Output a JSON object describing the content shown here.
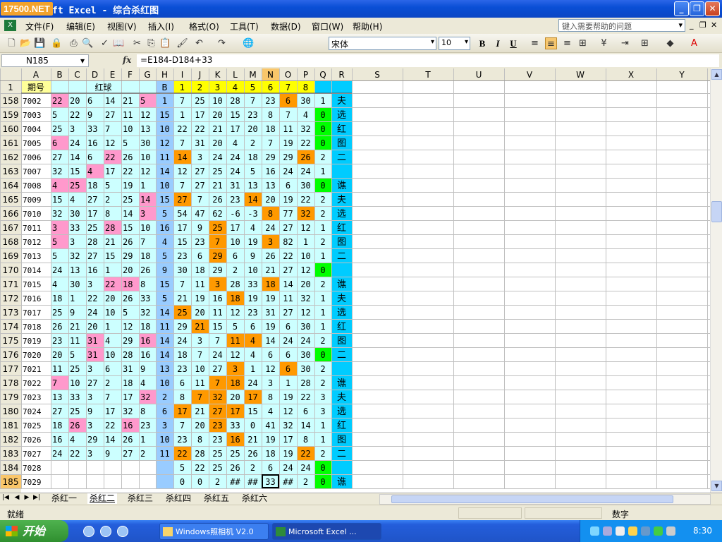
{
  "window": {
    "watermark": "17500.NET",
    "title": "ft Excel - 综合杀红图"
  },
  "menu": {
    "items": [
      "文件(F)",
      "编辑(E)",
      "视图(V)",
      "插入(I)",
      "格式(O)",
      "工具(T)",
      "数据(D)",
      "窗口(W)",
      "帮助(H)"
    ],
    "help_placeholder": "键入需要帮助的问题"
  },
  "toolbar": {
    "font": "宋体",
    "size": "10",
    "bold": "B",
    "italic": "I",
    "underline": "U"
  },
  "formula_bar": {
    "name_box": "N185",
    "fx": "fx",
    "formula": "=E184-D184+33"
  },
  "grid": {
    "columns": [
      "A",
      "B",
      "C",
      "D",
      "E",
      "F",
      "G",
      "H",
      "I",
      "J",
      "K",
      "L",
      "M",
      "N",
      "O",
      "P",
      "Q",
      "R",
      "S",
      "T",
      "U",
      "V",
      "W",
      "X",
      "Y"
    ],
    "header_row": {
      "row": "1",
      "a": "期号",
      "red": "红球",
      "h": "B",
      "nums": [
        "1",
        "2",
        "3",
        "4",
        "5",
        "6",
        "7",
        "8"
      ]
    },
    "rows": [
      [
        "158",
        "7002",
        "22",
        "20",
        "6",
        "14",
        "21",
        "5",
        "1",
        "7",
        "25",
        "10",
        "28",
        "7",
        "23",
        "6",
        "30",
        "1",
        "夫"
      ],
      [
        "159",
        "7003",
        "5",
        "22",
        "9",
        "27",
        "11",
        "12",
        "15",
        "1",
        "17",
        "20",
        "15",
        "23",
        "8",
        "7",
        "4",
        "0",
        "选"
      ],
      [
        "160",
        "7004",
        "25",
        "3",
        "33",
        "7",
        "10",
        "13",
        "10",
        "22",
        "22",
        "21",
        "17",
        "20",
        "18",
        "11",
        "32",
        "0",
        "红"
      ],
      [
        "161",
        "7005",
        "6",
        "24",
        "16",
        "12",
        "5",
        "30",
        "12",
        "7",
        "31",
        "20",
        "4",
        "2",
        "7",
        "19",
        "22",
        "0",
        "图"
      ],
      [
        "162",
        "7006",
        "27",
        "14",
        "6",
        "22",
        "26",
        "10",
        "11",
        "14",
        "3",
        "24",
        "24",
        "18",
        "29",
        "29",
        "26",
        "2",
        "二"
      ],
      [
        "163",
        "7007",
        "32",
        "15",
        "4",
        "17",
        "22",
        "12",
        "14",
        "12",
        "27",
        "25",
        "24",
        "5",
        "16",
        "24",
        "24",
        "1",
        ""
      ],
      [
        "164",
        "7008",
        "4",
        "25",
        "18",
        "5",
        "19",
        "1",
        "10",
        "7",
        "27",
        "21",
        "31",
        "13",
        "13",
        "6",
        "30",
        "0",
        "谯"
      ],
      [
        "165",
        "7009",
        "15",
        "4",
        "27",
        "2",
        "25",
        "14",
        "15",
        "27",
        "7",
        "26",
        "23",
        "14",
        "20",
        "19",
        "22",
        "2",
        "夫"
      ],
      [
        "166",
        "7010",
        "32",
        "30",
        "17",
        "8",
        "14",
        "3",
        "5",
        "54",
        "47",
        "62",
        "-6",
        "-3",
        "8",
        "77",
        "32",
        "2",
        "选"
      ],
      [
        "167",
        "7011",
        "3",
        "33",
        "25",
        "28",
        "15",
        "10",
        "16",
        "17",
        "9",
        "25",
        "17",
        "4",
        "24",
        "27",
        "12",
        "1",
        "红"
      ],
      [
        "168",
        "7012",
        "5",
        "3",
        "28",
        "21",
        "26",
        "7",
        "4",
        "15",
        "23",
        "7",
        "10",
        "19",
        "3",
        "82",
        "1",
        "2",
        "图"
      ],
      [
        "169",
        "7013",
        "5",
        "32",
        "27",
        "15",
        "29",
        "18",
        "5",
        "23",
        "6",
        "29",
        "6",
        "9",
        "26",
        "22",
        "10",
        "1",
        "二"
      ],
      [
        "170",
        "7014",
        "24",
        "13",
        "16",
        "1",
        "20",
        "26",
        "9",
        "30",
        "18",
        "29",
        "2",
        "10",
        "21",
        "27",
        "12",
        "0",
        ""
      ],
      [
        "171",
        "7015",
        "4",
        "30",
        "3",
        "22",
        "18",
        "8",
        "15",
        "7",
        "11",
        "3",
        "28",
        "33",
        "18",
        "14",
        "20",
        "2",
        "谯"
      ],
      [
        "172",
        "7016",
        "18",
        "1",
        "22",
        "20",
        "26",
        "33",
        "5",
        "21",
        "19",
        "16",
        "18",
        "19",
        "19",
        "11",
        "32",
        "1",
        "夫"
      ],
      [
        "173",
        "7017",
        "25",
        "9",
        "24",
        "10",
        "5",
        "32",
        "14",
        "25",
        "20",
        "11",
        "12",
        "23",
        "31",
        "27",
        "12",
        "1",
        "选"
      ],
      [
        "174",
        "7018",
        "26",
        "21",
        "20",
        "1",
        "12",
        "18",
        "11",
        "29",
        "21",
        "15",
        "5",
        "6",
        "19",
        "6",
        "30",
        "1",
        "红"
      ],
      [
        "175",
        "7019",
        "23",
        "11",
        "31",
        "4",
        "29",
        "16",
        "14",
        "24",
        "3",
        "7",
        "11",
        "4",
        "14",
        "24",
        "24",
        "2",
        "图"
      ],
      [
        "176",
        "7020",
        "20",
        "5",
        "31",
        "10",
        "28",
        "16",
        "14",
        "18",
        "7",
        "24",
        "12",
        "4",
        "6",
        "6",
        "30",
        "0",
        "二"
      ],
      [
        "177",
        "7021",
        "11",
        "25",
        "3",
        "6",
        "31",
        "9",
        "13",
        "23",
        "10",
        "27",
        "3",
        "1",
        "12",
        "6",
        "30",
        "2",
        ""
      ],
      [
        "178",
        "7022",
        "7",
        "10",
        "27",
        "2",
        "18",
        "4",
        "10",
        "6",
        "11",
        "7",
        "18",
        "24",
        "3",
        "1",
        "28",
        "2",
        "谯"
      ],
      [
        "179",
        "7023",
        "13",
        "33",
        "3",
        "7",
        "17",
        "32",
        "2",
        "8",
        "7",
        "32",
        "20",
        "17",
        "8",
        "19",
        "22",
        "3",
        "夫"
      ],
      [
        "180",
        "7024",
        "27",
        "25",
        "9",
        "17",
        "32",
        "8",
        "6",
        "17",
        "21",
        "27",
        "17",
        "15",
        "4",
        "12",
        "6",
        "3",
        "选"
      ],
      [
        "181",
        "7025",
        "18",
        "26",
        "3",
        "22",
        "16",
        "23",
        "3",
        "7",
        "20",
        "23",
        "33",
        "0",
        "41",
        "32",
        "14",
        "1",
        "红"
      ],
      [
        "182",
        "7026",
        "16",
        "4",
        "29",
        "14",
        "26",
        "1",
        "10",
        "23",
        "8",
        "23",
        "16",
        "21",
        "19",
        "17",
        "8",
        "1",
        "图"
      ],
      [
        "183",
        "7027",
        "24",
        "22",
        "3",
        "9",
        "27",
        "2",
        "11",
        "22",
        "28",
        "25",
        "25",
        "26",
        "18",
        "19",
        "22",
        "2",
        "二"
      ],
      [
        "184",
        "7028",
        "",
        "",
        "",
        "",
        "",
        "",
        "",
        "5",
        "22",
        "25",
        "26",
        "2",
        "6",
        "24",
        "24",
        "0",
        ""
      ],
      [
        "185",
        "7029",
        "",
        "",
        "",
        "",
        "",
        "",
        "",
        "0",
        "0",
        "2",
        "##",
        "##",
        "33",
        "##",
        "2",
        "0",
        "谯"
      ]
    ],
    "pink": [
      [
        158,
        "B"
      ],
      [
        158,
        "G"
      ],
      [
        161,
        "B"
      ],
      [
        162,
        "E"
      ],
      [
        163,
        "D"
      ],
      [
        164,
        "B"
      ],
      [
        164,
        "C"
      ],
      [
        165,
        "G"
      ],
      [
        166,
        "G"
      ],
      [
        167,
        "B"
      ],
      [
        167,
        "E"
      ],
      [
        168,
        "B"
      ],
      [
        171,
        "E"
      ],
      [
        171,
        "F"
      ],
      [
        175,
        "D"
      ],
      [
        175,
        "G"
      ],
      [
        176,
        "D"
      ],
      [
        178,
        "B"
      ],
      [
        179,
        "G"
      ],
      [
        181,
        "C"
      ],
      [
        181,
        "F"
      ]
    ],
    "orange": [
      [
        158,
        "O"
      ],
      [
        162,
        "I"
      ],
      [
        162,
        "P"
      ],
      [
        165,
        "I"
      ],
      [
        165,
        "M"
      ],
      [
        166,
        "N"
      ],
      [
        166,
        "P"
      ],
      [
        167,
        "K"
      ],
      [
        168,
        "K"
      ],
      [
        168,
        "N"
      ],
      [
        169,
        "K"
      ],
      [
        171,
        "K"
      ],
      [
        171,
        "N"
      ],
      [
        172,
        "L"
      ],
      [
        173,
        "I"
      ],
      [
        174,
        "J"
      ],
      [
        175,
        "L"
      ],
      [
        175,
        "M"
      ],
      [
        177,
        "L"
      ],
      [
        177,
        "O"
      ],
      [
        178,
        "K"
      ],
      [
        178,
        "L"
      ],
      [
        179,
        "J"
      ],
      [
        179,
        "K"
      ],
      [
        179,
        "M"
      ],
      [
        180,
        "I"
      ],
      [
        180,
        "K"
      ],
      [
        180,
        "L"
      ],
      [
        181,
        "K"
      ],
      [
        182,
        "L"
      ],
      [
        183,
        "I"
      ],
      [
        183,
        "P"
      ]
    ]
  },
  "sheets": {
    "tabs": [
      "杀红一",
      "杀红二",
      "杀红三",
      "杀红四",
      "杀红五",
      "杀红六"
    ],
    "active": 1
  },
  "status": {
    "ready": "就绪",
    "num": "数字"
  },
  "taskbar": {
    "start": "开始",
    "tasks": [
      "Windows照相机 V2.0",
      "Microsoft Excel ..."
    ],
    "clock": "8:30"
  }
}
